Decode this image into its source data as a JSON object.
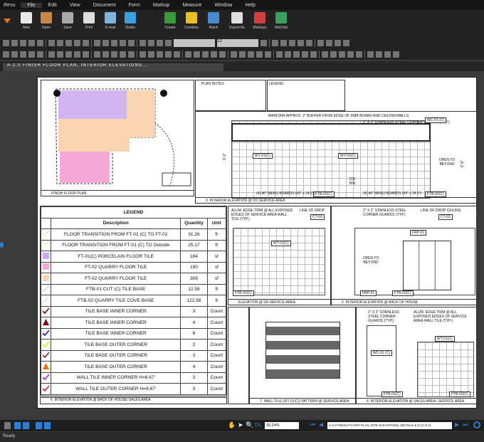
{
  "app": {
    "logo": "Revu"
  },
  "menu": [
    "File",
    "Edit",
    "View",
    "Document",
    "Form",
    "Markup",
    "Measure",
    "Window",
    "Help"
  ],
  "toolbar": [
    {
      "label": "New",
      "icon": "new-document-icon",
      "color": "#e8e8e8"
    },
    {
      "label": "Open",
      "icon": "folder-icon",
      "color": "#c9884a"
    },
    {
      "label": "Save",
      "icon": "floppy-icon",
      "color": "#aaaaaa"
    },
    {
      "label": "Print",
      "icon": "printer-icon",
      "color": "#dddddd"
    },
    {
      "label": "E-mail",
      "icon": "envelope-icon",
      "color": "#7fb3e0"
    },
    {
      "label": "Studio",
      "icon": "studio-icon",
      "color": "#3aa0e0"
    },
    {
      "label": "Create",
      "icon": "create-icon",
      "color": "#3a9a3a"
    },
    {
      "label": "Combine",
      "icon": "combine-icon",
      "color": "#e8c020"
    },
    {
      "label": "Batch",
      "icon": "batch-icon",
      "color": "#4a8ad0"
    },
    {
      "label": "Export As",
      "icon": "export-icon",
      "color": "#e0e0e0"
    },
    {
      "label": "Markups",
      "icon": "markups-icon",
      "color": "#d04040"
    },
    {
      "label": "WebTab",
      "icon": "globe-icon",
      "color": "#3aa060"
    }
  ],
  "font_size": "12",
  "tab": {
    "title": "A-2.0 FINISH FLOOR PLAN, INTERIOR ELEVATIONS..."
  },
  "drawing": {
    "plan_title": "FINISH FLOOR PLAN",
    "plan_notes_title": "PLAN NOTES",
    "legend_box_title": "LEGEND",
    "elev3": {
      "num": "3",
      "title": "INTERIOR ELEVATION @ DO SERVICE AREA",
      "note1": "MAINTAIN APPROX. 2\" BUFFER FROM EDGE OF DMB BOARD AND CEILING/WALLS",
      "note2": "2\" X 2\" STAINLESS STEEL CORNER GUARDS (TYP.)",
      "tag1": "WT-01(C)",
      "tag2": "WT-01(C)",
      "tag3": "WC-01 (C)",
      "tag4": "FTB-02(C)",
      "tag5": "FTB-02(C)",
      "mb1": "(4) 40\" MENU BOARDS (43\" x 24.5\")",
      "mb2": "(4) 40\" MENU BOARDS (43\" x 24.5\")",
      "open": "OPEN TO BEYOND",
      "ice": "ICE BIN",
      "dim1": "9'-2\"",
      "dim2": "6'-8\""
    },
    "elev_sr": {
      "title": "ELEVATION @ SR SERVICE AREA",
      "note": "ALUM. EDGE TRIM @ ALL EXPOSED EDGES OF SERVICE AREA WALL TILE (TYP.)",
      "drop": "LINE OF DROP",
      "ct": "CT-03",
      "tag": "WT-01(C)",
      "ftb": "FTB-02(C)"
    },
    "elev5": {
      "num": "5",
      "title": "INTERIOR ELEVATION @ BACK OF HOUSE",
      "note": "2\" X 2\" STAINLESS STEEL CORNER GUARDS (TYP.)",
      "drop": "LINE OF DROP CEILING",
      "ct": "CT-03",
      "frp": "FRP-01",
      "frp2": "FRP-01",
      "ftb": "FTB-02(C)",
      "open": "OPEN TO BEYOND"
    },
    "elev6": {
      "num": "6",
      "title": "INTERIOR ELEVATION @ BACK OF HOUSE/ SALES AREA"
    },
    "elev7": {
      "num": "7",
      "title": "WALL TILE (WT-01(C)) PATTERN @ SERVICE AREA"
    },
    "elev8": {
      "num": "8",
      "title": "INTERIOR ELEVATION @ SALES AREA / SERVICE AREA",
      "note1": "2\" X 2\" STAINLESS STEEL CORNER GUARDS (TYP.)",
      "note2": "ALUM. EDGE TRIM @ ALL EXPOSED EDGES OF SERVICE AREA WALL TILE (TYP.)",
      "tag1": "WC-01 (C)",
      "tag2": "WT-01(C)",
      "ftb1": "FTB-01(C)",
      "ftb2": "FTB-02(C)"
    }
  },
  "legend": {
    "title": "LEGEND",
    "headers": [
      "Description",
      "Quantity",
      "Unit"
    ],
    "rows": [
      {
        "desc": "FLOOR TRANSITION FROM FT-01 (C) TO FT-02",
        "qty": "31.26",
        "unit": "ft",
        "symbol": "line",
        "color": "#e8e0a0"
      },
      {
        "desc": "FLOOR TRANSITION FROM FT-01 (C) TO Outside",
        "qty": "25.17",
        "unit": "ft",
        "symbol": "line",
        "color": "#f0f0a0"
      },
      {
        "desc": "FT-01(C) PORCELAIN FLOOR TILE",
        "qty": "184",
        "unit": "sf",
        "symbol": "square",
        "color": "#c9a8f0"
      },
      {
        "desc": "FT-02 QUARRY FLOOR TILE",
        "qty": "190",
        "unit": "sf",
        "symbol": "square",
        "color": "#f4a8d8"
      },
      {
        "desc": "FT-02 QUARRY FLOOR TILE",
        "qty": "309",
        "unit": "sf",
        "symbol": "square",
        "color": "#f8d4b0"
      },
      {
        "desc": "FTB-01 CUT (C) TILE BASE",
        "qty": "12.58",
        "unit": "ft",
        "symbol": "line",
        "color": "#e0b0b8"
      },
      {
        "desc": "FTB-02 QUARRY TILE COVE BASE",
        "qty": "122.56",
        "unit": "ft",
        "symbol": "line",
        "color": "#d0c8e0"
      },
      {
        "desc": "TILE BASE INNER CORNER",
        "qty": "3",
        "unit": "Count",
        "symbol": "check",
        "color": "#6a1020"
      },
      {
        "desc": "TILE BASE INNER CORNER",
        "qty": "4",
        "unit": "Count",
        "symbol": "triangle",
        "color": "#7a0a10"
      },
      {
        "desc": "TILE BASE INNER CORNER",
        "qty": "6",
        "unit": "Count",
        "symbol": "check",
        "color": "#1a1aa0"
      },
      {
        "desc": "TILE BASE OUTER CORNER",
        "qty": "2",
        "unit": "Count",
        "symbol": "check",
        "color": "#e8e020"
      },
      {
        "desc": "TILE BASE OUTER CORNER",
        "qty": "3",
        "unit": "Count",
        "symbol": "check",
        "color": "#7a2040"
      },
      {
        "desc": "TILE BASE OUTER CORNER",
        "qty": "4",
        "unit": "Count",
        "symbol": "triangle",
        "color": "#e87010"
      },
      {
        "desc": "WALL TILE INNER CORNER H=8.67'",
        "qty": "3",
        "unit": "Count",
        "symbol": "check",
        "color": "#c020c0"
      },
      {
        "desc": "WALL TILE OUTER CORNER H=8.67'",
        "qty": "3",
        "unit": "Count",
        "symbol": "check",
        "color": "#c02040"
      }
    ]
  },
  "bottom": {
    "zoom": "35.24%",
    "page_label": "A-2.0 FINISH FLOOR PLAN, INTE ELEVATIONS, DETAILS & N (3 of 4)"
  },
  "status": "Ready"
}
